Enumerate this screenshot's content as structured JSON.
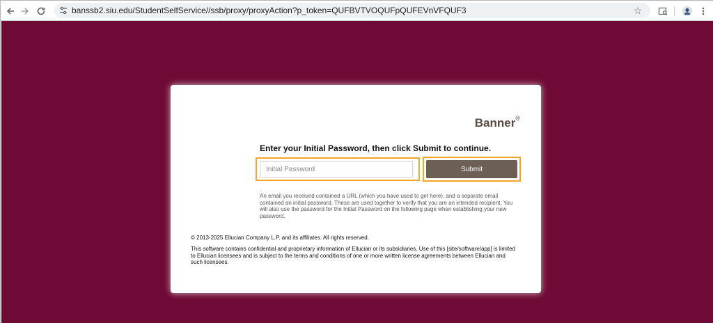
{
  "browser": {
    "url": "banssb2.siu.edu/StudentSelfService//ssb/proxy/proxyAction?p_token=QUFBVTVOQUFpQUFEVnVFQUF3",
    "icons": {
      "back": "back-arrow-icon",
      "forward": "forward-arrow-icon",
      "reload": "reload-icon",
      "site_info": "tune-icon",
      "bookmark": "star-icon",
      "search_tab": "search-tab-icon",
      "profile": "profile-avatar-icon"
    }
  },
  "page": {
    "background_color": "#6e0a33",
    "brand": {
      "name": "Banner",
      "mark": "®"
    },
    "heading": "Enter your Initial Password, then click Submit to continue.",
    "password_field": {
      "placeholder": "Initial Password",
      "value": ""
    },
    "submit_label": "Submit",
    "submit_color": "#6d5e56",
    "highlight_color": "#f5a623",
    "info_text": "An email you received contained a URL (which you have used to get here), and a separate email contained an initial password. These are used together to verify that you are an intended recipient. You will also use the password for the Initial Password on the following page when establishing your new password.",
    "copyright": "© 2013-2025 Ellucian Company L.P. and its affiliates. All rights reserved.",
    "license": "This software contains confidential and proprietary information of Ellucian or its subsidiaries. Use of this [site/software/app] is limited to Ellucian licensees and is subject to the terms and conditions of one or more written license agreements between Ellucian and such licensees."
  }
}
